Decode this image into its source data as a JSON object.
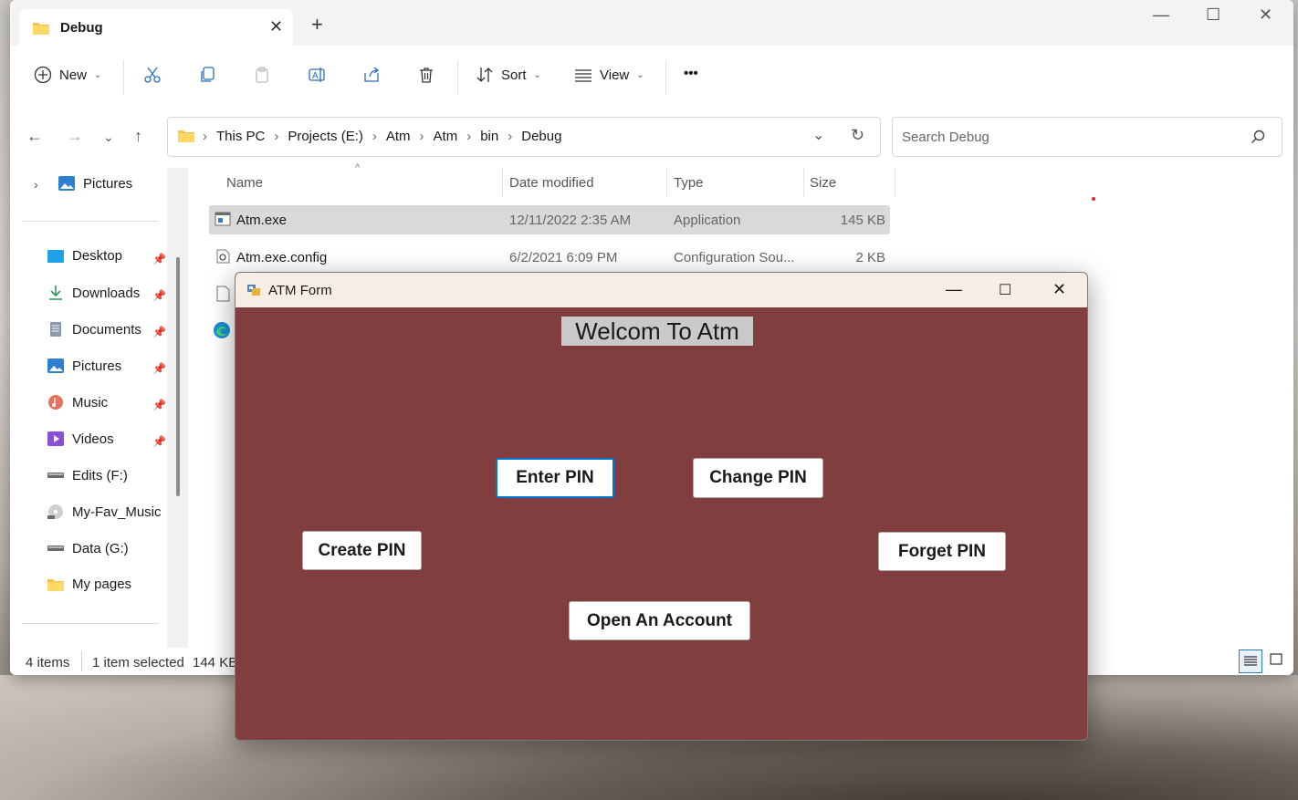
{
  "explorer": {
    "tab_title": "Debug",
    "toolbar": {
      "new_label": "New",
      "sort_label": "Sort",
      "view_label": "View",
      "more_label": "•••"
    },
    "breadcrumb": [
      "This PC",
      "Projects (E:)",
      "Atm",
      "Atm",
      "bin",
      "Debug"
    ],
    "search_placeholder": "Search Debug",
    "sidebar": {
      "top_item": "Pictures",
      "items": [
        {
          "label": "Desktop",
          "pinned": true
        },
        {
          "label": "Downloads",
          "pinned": true
        },
        {
          "label": "Documents",
          "pinned": true
        },
        {
          "label": "Pictures",
          "pinned": true
        },
        {
          "label": "Music",
          "pinned": true
        },
        {
          "label": "Videos",
          "pinned": true
        },
        {
          "label": "Edits (F:)",
          "pinned": false
        },
        {
          "label": "My-Fav_Music",
          "pinned": false
        },
        {
          "label": "Data (G:)",
          "pinned": false
        },
        {
          "label": "My pages",
          "pinned": false
        }
      ]
    },
    "columns": {
      "name": "Name",
      "date": "Date modified",
      "type": "Type",
      "size": "Size"
    },
    "files": [
      {
        "name": "Atm.exe",
        "date": "12/11/2022 2:35 AM",
        "type": "Application",
        "size": "145 KB",
        "selected": true
      },
      {
        "name": "Atm.exe.config",
        "date": "6/2/2021 6:09 PM",
        "type": "Configuration Sou...",
        "size": "2 KB",
        "selected": false
      }
    ],
    "status": {
      "items": "4 items",
      "selected": "1 item selected",
      "size": "144 KB"
    }
  },
  "atm_form": {
    "title": "ATM Form",
    "welcome": "Welcom To Atm",
    "buttons": {
      "enter_pin": "Enter PIN",
      "change_pin": "Change PIN",
      "create_pin": "Create PIN",
      "forget_pin": "Forget PIN",
      "open_account": "Open An Account"
    },
    "background_color": "#813e3e"
  }
}
